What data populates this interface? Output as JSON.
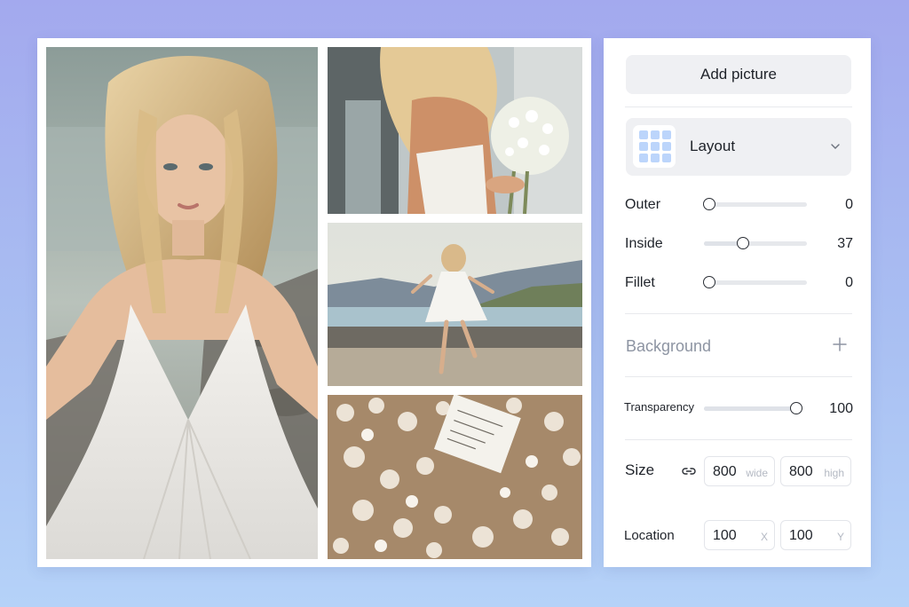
{
  "panel": {
    "add_picture_label": "Add picture",
    "layout": {
      "label": "Layout",
      "icon": "grid-icon",
      "chevron": "chevron-down-icon"
    },
    "sliders": [
      {
        "label": "Outer",
        "value": "0",
        "fraction": 0.0
      },
      {
        "label": "Inside",
        "value": "37",
        "fraction": 0.37
      },
      {
        "label": "Fillet",
        "value": "0",
        "fraction": 0.0
      }
    ],
    "background": {
      "label": "Background",
      "icon": "plus-icon"
    },
    "transparency": {
      "label": "Transparency",
      "value": "100",
      "fraction": 1.0
    },
    "size": {
      "label": "Size",
      "icon": "link-icon",
      "width": "800",
      "width_unit": "wide",
      "height": "800",
      "height_unit": "high"
    },
    "location": {
      "label": "Location",
      "x": "100",
      "x_unit": "X",
      "y": "100",
      "y_unit": "Y"
    }
  },
  "colors": {
    "accent_light": "#bcd5fb",
    "panel_bg": "#ffffff",
    "button_bg": "#eff0f3",
    "muted_text": "#8d94a2"
  }
}
